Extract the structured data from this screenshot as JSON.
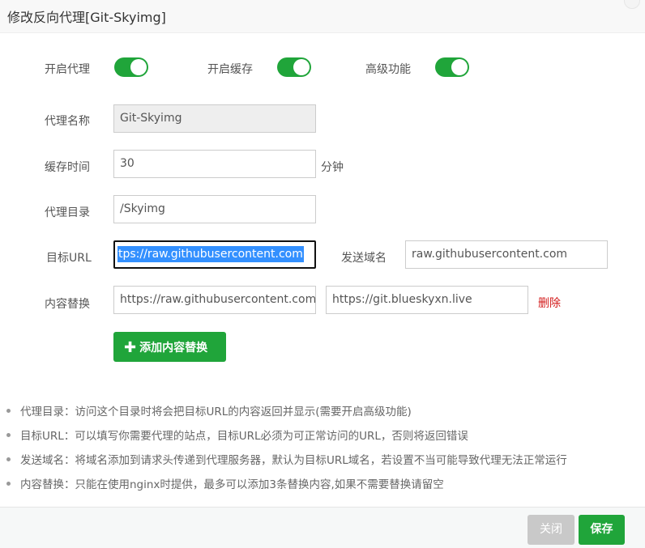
{
  "dialog": {
    "title": "修改反向代理[Git-Skyimg]"
  },
  "toggles": {
    "proxy": {
      "label": "开启代理",
      "on": true
    },
    "cache": {
      "label": "开启缓存",
      "on": true
    },
    "advanced": {
      "label": "高级功能",
      "on": true
    }
  },
  "form": {
    "name": {
      "label": "代理名称",
      "value": "Git-Skyimg"
    },
    "cache_time": {
      "label": "缓存时间",
      "value": "30",
      "unit": "分钟"
    },
    "dir": {
      "label": "代理目录",
      "value": "/Skyimg"
    },
    "target": {
      "label": "目标URL",
      "value": "tps://raw.githubusercontent.com"
    },
    "send_domain": {
      "label": "发送域名",
      "value": "raw.githubusercontent.com"
    },
    "replace": {
      "label": "内容替换",
      "from": "https://raw.githubusercontent.com",
      "to": "https://git.blueskyxn.live",
      "delete_label": "删除"
    },
    "add_replace_label": "添加内容替换"
  },
  "tips": [
    "代理目录：访问这个目录时将会把目标URL的内容返回并显示(需要开启高级功能)",
    "目标URL：可以填写你需要代理的站点，目标URL必须为可正常访问的URL，否则将返回错误",
    "发送域名：将域名添加到请求头传递到代理服务器，默认为目标URL域名，若设置不当可能导致代理无法正常运行",
    "内容替换：只能在使用nginx时提供，最多可以添加3条替换内容,如果不需要替换请留空"
  ],
  "footer": {
    "close_label": "关闭",
    "save_label": "保存"
  },
  "colors": {
    "accent": "#20a53a",
    "danger": "#d31c1c",
    "disabled_btn": "#c9c9c9"
  }
}
